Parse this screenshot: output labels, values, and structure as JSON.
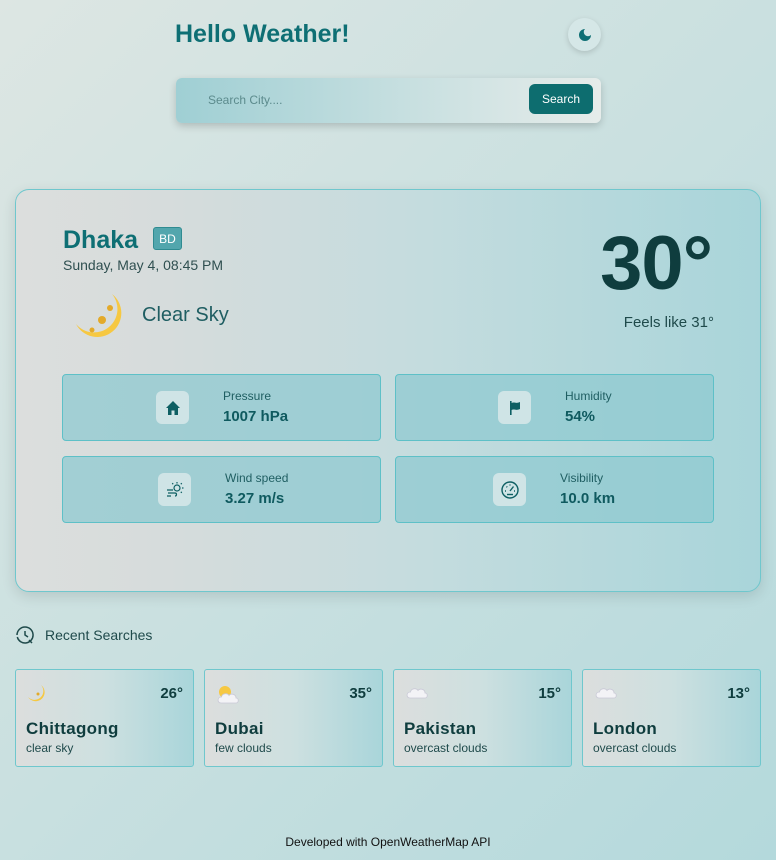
{
  "header": {
    "title": "Hello Weather!"
  },
  "search": {
    "placeholder": "Search City....",
    "button_label": "Search"
  },
  "current": {
    "city": "Dhaka",
    "country": "BD",
    "date": "Sunday, May 4, 08:45 PM",
    "condition": "Clear Sky",
    "condition_icon": "crescent-moon-icon",
    "temperature": "30°",
    "feels_like": "Feels like 31°"
  },
  "stats": [
    {
      "label": "Pressure",
      "value": "1007 hPa",
      "icon": "home-icon"
    },
    {
      "label": "Humidity",
      "value": "54%",
      "icon": "flag-icon"
    },
    {
      "label": "Wind speed",
      "value": "3.27 m/s",
      "icon": "wind-sun-icon"
    },
    {
      "label": "Visibility",
      "value": "10.0 km",
      "icon": "gauge-icon"
    }
  ],
  "recent": {
    "title": "Recent Searches",
    "items": [
      {
        "city": "Chittagong",
        "temp": "26°",
        "desc": "clear sky",
        "icon": "crescent-moon-icon"
      },
      {
        "city": "Dubai",
        "temp": "35°",
        "desc": "few clouds",
        "icon": "sun-cloud-icon"
      },
      {
        "city": "Pakistan",
        "temp": "15°",
        "desc": "overcast clouds",
        "icon": "cloud-icon"
      },
      {
        "city": "London",
        "temp": "13°",
        "desc": "overcast clouds",
        "icon": "cloud-icon"
      }
    ]
  },
  "footer": {
    "text": "Developed with OpenWeatherMap API"
  },
  "colors": {
    "accent": "#0d6d6f",
    "card_border": "#6fc7cd",
    "stat_bg": "#8fc9d0"
  }
}
